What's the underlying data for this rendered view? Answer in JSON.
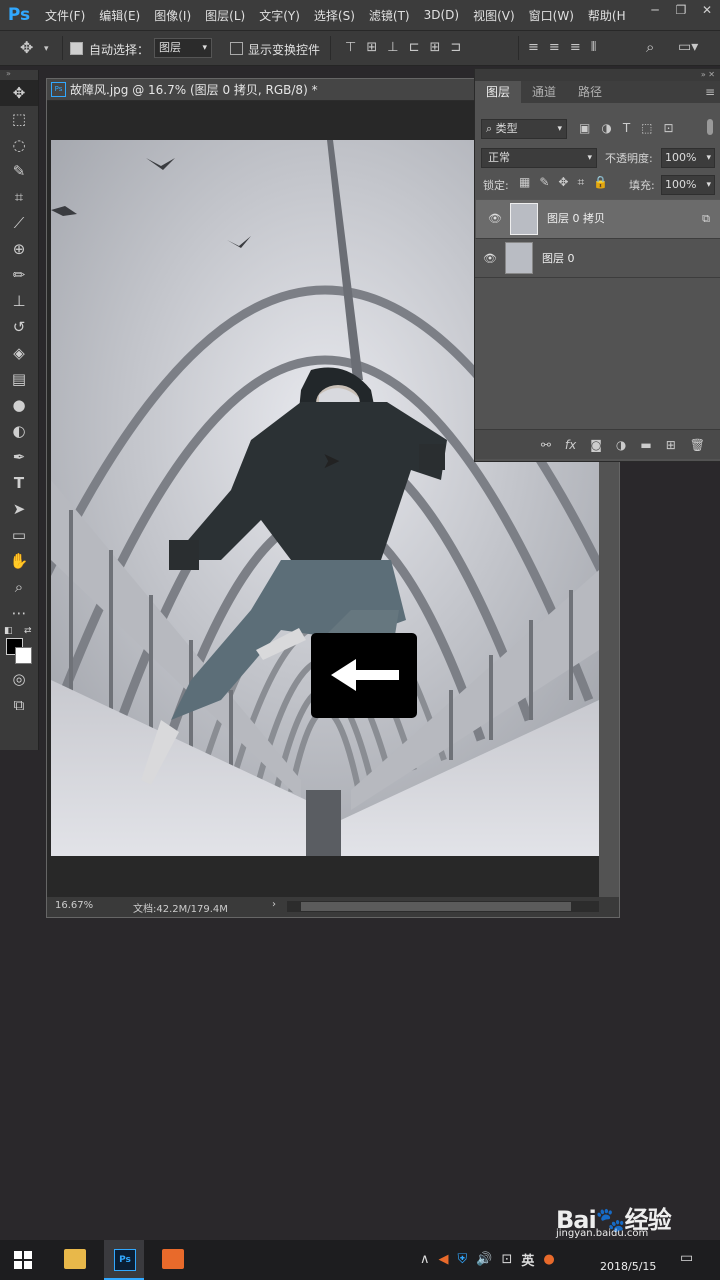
{
  "app": {
    "logo": "Ps"
  },
  "menu": [
    "文件(F)",
    "编辑(E)",
    "图像(I)",
    "图层(L)",
    "文字(Y)",
    "选择(S)",
    "滤镜(T)",
    "3D(D)",
    "视图(V)",
    "窗口(W)",
    "帮助(H"
  ],
  "options_bar": {
    "auto_select_label": "自动选择：",
    "auto_select_checked": true,
    "auto_select_target": "图层",
    "show_transform_label": "显示变换控件",
    "show_transform_checked": false
  },
  "document": {
    "title": "故障风.jpg @ 16.7% (图层 0 拷贝, RGB/8) *",
    "zoom": "16.67%",
    "doc_size": "文档:42.2M/179.4M"
  },
  "layers_panel": {
    "tabs": [
      {
        "label": "图层",
        "active": true
      },
      {
        "label": "通道",
        "active": false
      },
      {
        "label": "路径",
        "active": false
      }
    ],
    "filter_label": "类型",
    "blend_mode": "正常",
    "opacity_label": "不透明度:",
    "opacity_value": "100%",
    "lock_label": "锁定:",
    "fill_label": "填充:",
    "fill_value": "100%",
    "layers": [
      {
        "name": "图层 0 拷贝",
        "selected": true
      },
      {
        "name": "图层 0",
        "selected": false
      }
    ],
    "footer_icons": [
      "link-icon",
      "fx-icon",
      "mask-icon",
      "adjustment-icon",
      "folder-icon",
      "new-layer-icon",
      "trash-icon"
    ]
  },
  "overlay": {
    "arrow_direction": "left"
  },
  "taskbar": {
    "date": "2018/5/15",
    "ime": "英",
    "watermark_url": "jingyan.baidu.com"
  },
  "colors": {
    "accent": "#31a8ff",
    "panel": "#535353",
    "background": "#2a282b"
  }
}
